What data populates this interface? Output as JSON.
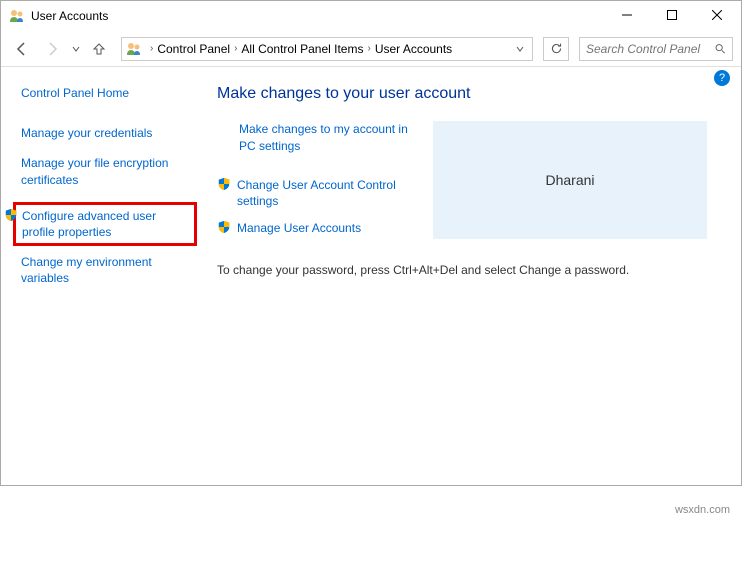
{
  "titlebar": {
    "title": "User Accounts"
  },
  "breadcrumb": {
    "items": [
      "Control Panel",
      "All Control Panel Items",
      "User Accounts"
    ]
  },
  "search": {
    "placeholder": "Search Control Panel"
  },
  "sidebar": {
    "home": "Control Panel Home",
    "items": [
      "Manage your credentials",
      "Manage your file encryption certificates",
      "Configure advanced user profile properties",
      "Change my environment variables"
    ]
  },
  "main": {
    "heading": "Make changes to your user account",
    "link_pc_settings": "Make changes to my account in PC settings",
    "link_uac": "Change User Account Control settings",
    "link_manage": "Manage User Accounts",
    "account_name": "Dharani",
    "password_hint": "To change your password, press Ctrl+Alt+Del and select Change a password."
  },
  "watermark": "wsxdn.com"
}
